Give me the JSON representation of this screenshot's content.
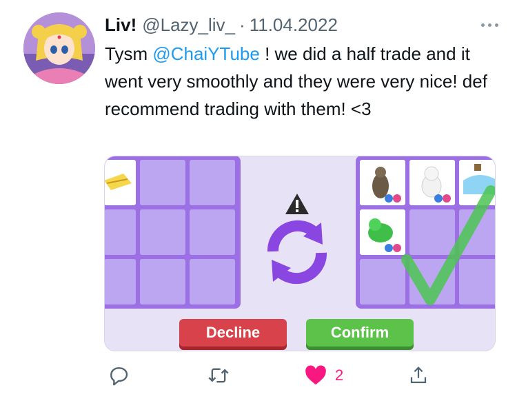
{
  "tweet": {
    "display_name": "Liv!",
    "handle": "@Lazy_liv_",
    "separator": "·",
    "date": "11.04.2022",
    "text_before": "Tysm ",
    "mention": "@ChaiYTube",
    "text_after": " ! we did a half trade and it went very smoothly and they were very nice! def recommend trading with them! <3"
  },
  "media": {
    "decline_label": "Decline",
    "confirm_label": "Confirm"
  },
  "actions": {
    "likes": "2"
  },
  "colors": {
    "mention": "#1d9bf0",
    "like": "#f91880",
    "panel": "#9c70e4",
    "decline": "#d8434b",
    "confirm": "#5dc24a"
  },
  "icons": [
    "more-icon",
    "warning-icon",
    "swap-icon",
    "checkmark-icon",
    "reply-icon",
    "retweet-icon",
    "heart-icon",
    "share-icon"
  ]
}
